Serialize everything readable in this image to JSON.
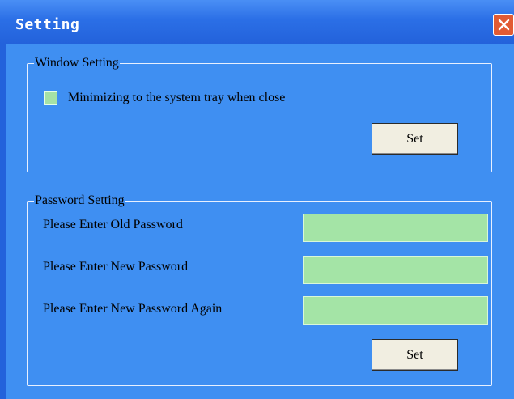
{
  "window": {
    "title": "Setting"
  },
  "window_setting": {
    "legend": "Window Setting",
    "checkbox_label": "Minimizing to the system tray when close",
    "checked": false,
    "set_label": "Set"
  },
  "password_setting": {
    "legend": "Password Setting",
    "old_label": "Please Enter Old Password",
    "new_label": "Please Enter New Password",
    "again_label": "Please Enter New Password Again",
    "old_value": "",
    "new_value": "",
    "again_value": "",
    "set_label": "Set"
  },
  "colors": {
    "client_bg": "#3f8ff2",
    "input_bg": "#a4e4a6",
    "title_bar": "#2b6fe6",
    "close_button": "#e25b34"
  },
  "icons": {
    "close": "close-icon"
  }
}
